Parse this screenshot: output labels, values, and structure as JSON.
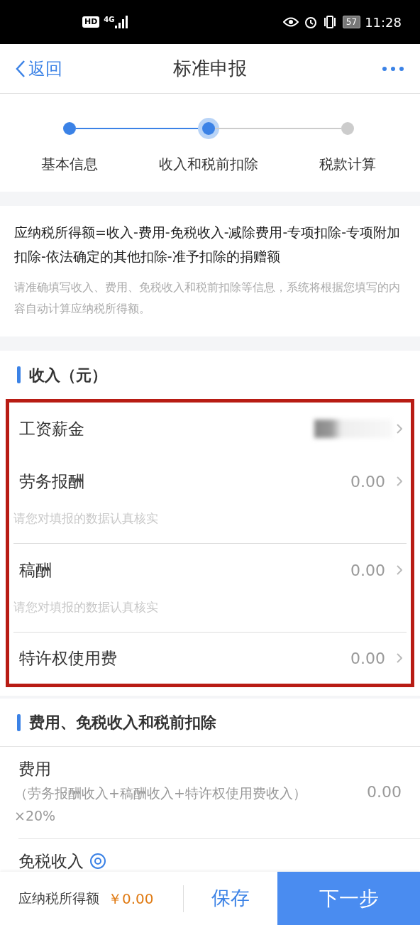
{
  "status_bar": {
    "time": "11:28",
    "network": "4G",
    "hd": "HD",
    "battery": "57"
  },
  "header": {
    "back": "返回",
    "title": "标准申报"
  },
  "steps": [
    {
      "label": "基本信息",
      "reached": true,
      "selected": false
    },
    {
      "label": "收入和税前扣除",
      "reached": true,
      "selected": true
    },
    {
      "label": "税款计算",
      "reached": false,
      "selected": false
    }
  ],
  "formula": {
    "text": "应纳税所得额=收入-费用-免税收入-减除费用-专项扣除-专项附加扣除-依法确定的其他扣除-准予扣除的捐赠额",
    "note": "请准确填写收入、费用、免税收入和税前扣除等信息，系统将根据您填写的内容自动计算应纳税所得额。"
  },
  "income": {
    "title": "收入（元）",
    "highlighted": true,
    "rows": [
      {
        "label": "工资薪金",
        "redacted": true
      },
      {
        "label": "劳务报酬",
        "value": "0.00",
        "hint": "请您对填报的数据认真核实"
      },
      {
        "label": "稿酬",
        "value": "0.00",
        "hint": "请您对填报的数据认真核实"
      },
      {
        "label": "特许权使用费",
        "value": "0.00"
      }
    ]
  },
  "deductions": {
    "title": "费用、免税收入和税前扣除",
    "rows": [
      {
        "label": "费用",
        "note": "（劳务报酬收入+稿酬收入+特许权使用费收入）×20%",
        "value": "0.00"
      },
      {
        "label": "免税收入",
        "help": true
      }
    ]
  },
  "bottom_bar": {
    "label": "应纳税所得额",
    "amount": "￥0.00",
    "save": "保存",
    "next": "下一步"
  }
}
